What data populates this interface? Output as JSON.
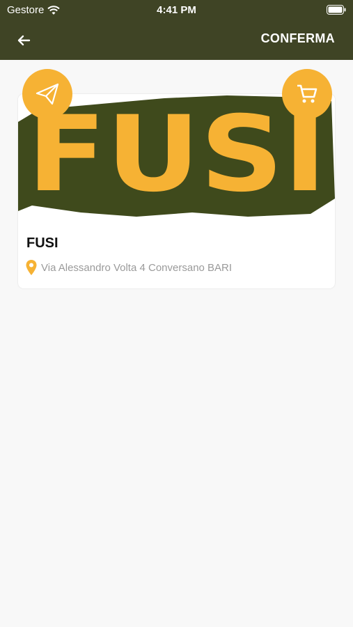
{
  "status_bar": {
    "carrier": "Gestore",
    "time": "4:41 PM"
  },
  "nav": {
    "confirm_label": "CONFERMA"
  },
  "store": {
    "name": "FUSI",
    "logo_text": "FUSI",
    "address": "Via Alessandro Volta 4 Conversano BARI"
  },
  "colors": {
    "header": "#3f4425",
    "accent": "#f6b234",
    "logo_shadow": "#3f4a1c"
  },
  "icons": [
    "wifi-icon",
    "battery-icon",
    "back-arrow-icon",
    "send-icon",
    "cart-icon",
    "location-pin-icon"
  ]
}
